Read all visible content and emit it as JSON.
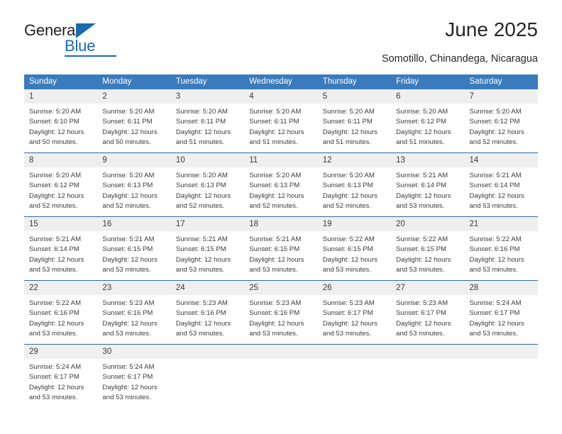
{
  "brand": {
    "name_top": "General",
    "name_bottom": "Blue",
    "accent_color": "#1a6bb0",
    "triangle_icon": "triangle-icon"
  },
  "header": {
    "title": "June 2025",
    "subtitle": "Somotillo, Chinandega, Nicaragua"
  },
  "calendar": {
    "header_color": "#3a7bbd",
    "row_divider_color": "#2d6ca8",
    "daynum_band_color": "#efefef",
    "weekdays": [
      "Sunday",
      "Monday",
      "Tuesday",
      "Wednesday",
      "Thursday",
      "Friday",
      "Saturday"
    ],
    "weeks": [
      [
        {
          "day": "1",
          "lines": [
            "Sunrise: 5:20 AM",
            "Sunset: 6:10 PM",
            "Daylight: 12 hours",
            "and 50 minutes."
          ]
        },
        {
          "day": "2",
          "lines": [
            "Sunrise: 5:20 AM",
            "Sunset: 6:11 PM",
            "Daylight: 12 hours",
            "and 50 minutes."
          ]
        },
        {
          "day": "3",
          "lines": [
            "Sunrise: 5:20 AM",
            "Sunset: 6:11 PM",
            "Daylight: 12 hours",
            "and 51 minutes."
          ]
        },
        {
          "day": "4",
          "lines": [
            "Sunrise: 5:20 AM",
            "Sunset: 6:11 PM",
            "Daylight: 12 hours",
            "and 51 minutes."
          ]
        },
        {
          "day": "5",
          "lines": [
            "Sunrise: 5:20 AM",
            "Sunset: 6:11 PM",
            "Daylight: 12 hours",
            "and 51 minutes."
          ]
        },
        {
          "day": "6",
          "lines": [
            "Sunrise: 5:20 AM",
            "Sunset: 6:12 PM",
            "Daylight: 12 hours",
            "and 51 minutes."
          ]
        },
        {
          "day": "7",
          "lines": [
            "Sunrise: 5:20 AM",
            "Sunset: 6:12 PM",
            "Daylight: 12 hours",
            "and 52 minutes."
          ]
        }
      ],
      [
        {
          "day": "8",
          "lines": [
            "Sunrise: 5:20 AM",
            "Sunset: 6:12 PM",
            "Daylight: 12 hours",
            "and 52 minutes."
          ]
        },
        {
          "day": "9",
          "lines": [
            "Sunrise: 5:20 AM",
            "Sunset: 6:13 PM",
            "Daylight: 12 hours",
            "and 52 minutes."
          ]
        },
        {
          "day": "10",
          "lines": [
            "Sunrise: 5:20 AM",
            "Sunset: 6:13 PM",
            "Daylight: 12 hours",
            "and 52 minutes."
          ]
        },
        {
          "day": "11",
          "lines": [
            "Sunrise: 5:20 AM",
            "Sunset: 6:13 PM",
            "Daylight: 12 hours",
            "and 52 minutes."
          ]
        },
        {
          "day": "12",
          "lines": [
            "Sunrise: 5:20 AM",
            "Sunset: 6:13 PM",
            "Daylight: 12 hours",
            "and 52 minutes."
          ]
        },
        {
          "day": "13",
          "lines": [
            "Sunrise: 5:21 AM",
            "Sunset: 6:14 PM",
            "Daylight: 12 hours",
            "and 53 minutes."
          ]
        },
        {
          "day": "14",
          "lines": [
            "Sunrise: 5:21 AM",
            "Sunset: 6:14 PM",
            "Daylight: 12 hours",
            "and 53 minutes."
          ]
        }
      ],
      [
        {
          "day": "15",
          "lines": [
            "Sunrise: 5:21 AM",
            "Sunset: 6:14 PM",
            "Daylight: 12 hours",
            "and 53 minutes."
          ]
        },
        {
          "day": "16",
          "lines": [
            "Sunrise: 5:21 AM",
            "Sunset: 6:15 PM",
            "Daylight: 12 hours",
            "and 53 minutes."
          ]
        },
        {
          "day": "17",
          "lines": [
            "Sunrise: 5:21 AM",
            "Sunset: 6:15 PM",
            "Daylight: 12 hours",
            "and 53 minutes."
          ]
        },
        {
          "day": "18",
          "lines": [
            "Sunrise: 5:21 AM",
            "Sunset: 6:15 PM",
            "Daylight: 12 hours",
            "and 53 minutes."
          ]
        },
        {
          "day": "19",
          "lines": [
            "Sunrise: 5:22 AM",
            "Sunset: 6:15 PM",
            "Daylight: 12 hours",
            "and 53 minutes."
          ]
        },
        {
          "day": "20",
          "lines": [
            "Sunrise: 5:22 AM",
            "Sunset: 6:15 PM",
            "Daylight: 12 hours",
            "and 53 minutes."
          ]
        },
        {
          "day": "21",
          "lines": [
            "Sunrise: 5:22 AM",
            "Sunset: 6:16 PM",
            "Daylight: 12 hours",
            "and 53 minutes."
          ]
        }
      ],
      [
        {
          "day": "22",
          "lines": [
            "Sunrise: 5:22 AM",
            "Sunset: 6:16 PM",
            "Daylight: 12 hours",
            "and 53 minutes."
          ]
        },
        {
          "day": "23",
          "lines": [
            "Sunrise: 5:23 AM",
            "Sunset: 6:16 PM",
            "Daylight: 12 hours",
            "and 53 minutes."
          ]
        },
        {
          "day": "24",
          "lines": [
            "Sunrise: 5:23 AM",
            "Sunset: 6:16 PM",
            "Daylight: 12 hours",
            "and 53 minutes."
          ]
        },
        {
          "day": "25",
          "lines": [
            "Sunrise: 5:23 AM",
            "Sunset: 6:16 PM",
            "Daylight: 12 hours",
            "and 53 minutes."
          ]
        },
        {
          "day": "26",
          "lines": [
            "Sunrise: 5:23 AM",
            "Sunset: 6:17 PM",
            "Daylight: 12 hours",
            "and 53 minutes."
          ]
        },
        {
          "day": "27",
          "lines": [
            "Sunrise: 5:23 AM",
            "Sunset: 6:17 PM",
            "Daylight: 12 hours",
            "and 53 minutes."
          ]
        },
        {
          "day": "28",
          "lines": [
            "Sunrise: 5:24 AM",
            "Sunset: 6:17 PM",
            "Daylight: 12 hours",
            "and 53 minutes."
          ]
        }
      ],
      [
        {
          "day": "29",
          "lines": [
            "Sunrise: 5:24 AM",
            "Sunset: 6:17 PM",
            "Daylight: 12 hours",
            "and 53 minutes."
          ]
        },
        {
          "day": "30",
          "lines": [
            "Sunrise: 5:24 AM",
            "Sunset: 6:17 PM",
            "Daylight: 12 hours",
            "and 53 minutes."
          ]
        },
        {
          "day": "",
          "lines": []
        },
        {
          "day": "",
          "lines": []
        },
        {
          "day": "",
          "lines": []
        },
        {
          "day": "",
          "lines": []
        },
        {
          "day": "",
          "lines": []
        }
      ]
    ]
  }
}
